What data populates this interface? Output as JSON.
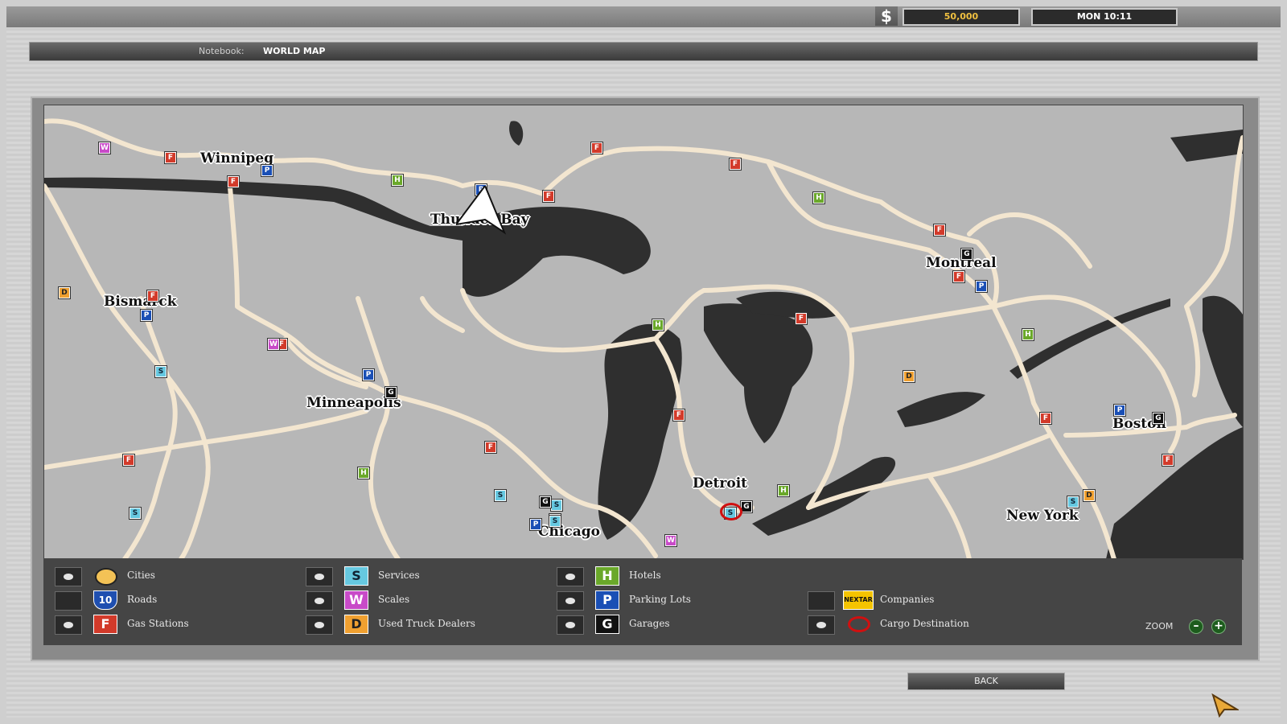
{
  "header": {
    "money": "50,000",
    "time": "MON 10:11",
    "notebook_label": "Notebook:",
    "notebook_value": "WORLD MAP"
  },
  "map": {
    "cities": [
      {
        "name": "Winnipeg"
      },
      {
        "name": "Thunder Bay"
      },
      {
        "name": "Bismarck"
      },
      {
        "name": "Montreal"
      },
      {
        "name": "Minneapolis"
      },
      {
        "name": "Boston"
      },
      {
        "name": "Detroit"
      },
      {
        "name": "New York"
      },
      {
        "name": "Chicago"
      }
    ],
    "markers": [
      "W",
      "F",
      "F",
      "P",
      "H",
      "P",
      "F",
      "F",
      "F",
      "H",
      "F",
      "G",
      "P",
      "F",
      "D",
      "F",
      "P",
      "F",
      "W",
      "S",
      "P",
      "G",
      "F",
      "S",
      "S",
      "H",
      "F",
      "S",
      "S",
      "G",
      "S",
      "P",
      "F",
      "S",
      "G",
      "H",
      "D",
      "F",
      "H",
      "P",
      "G",
      "F",
      "D",
      "S",
      "F",
      "H",
      "W"
    ]
  },
  "legend": {
    "items": [
      {
        "label": "Cities",
        "icon": "cities-icon",
        "on": true
      },
      {
        "label": "Roads",
        "icon": "roads-icon",
        "on": false
      },
      {
        "label": "Gas Stations",
        "icon": "F",
        "on": true
      },
      {
        "label": "Services",
        "icon": "S",
        "on": true
      },
      {
        "label": "Scales",
        "icon": "W",
        "on": true
      },
      {
        "label": "Used Truck Dealers",
        "icon": "D",
        "on": true
      },
      {
        "label": "Hotels",
        "icon": "H",
        "on": true
      },
      {
        "label": "Parking Lots",
        "icon": "P",
        "on": true
      },
      {
        "label": "Garages",
        "icon": "G",
        "on": true
      },
      {
        "label": "Companies",
        "icon": "NEXTAR",
        "on": false
      },
      {
        "label": "Cargo Destination",
        "icon": "cargo-ring-icon",
        "on": true
      }
    ],
    "zoom_label": "ZOOM",
    "zoom_out": "–",
    "zoom_in": "+",
    "road_shield": "10",
    "company_logo": "NEXTAR"
  },
  "back_label": "BACK",
  "colors": {
    "water": "#2f2f2f",
    "land": "#b7b7b7",
    "road": "#f3e6d0",
    "legend_bg": "#454545"
  }
}
